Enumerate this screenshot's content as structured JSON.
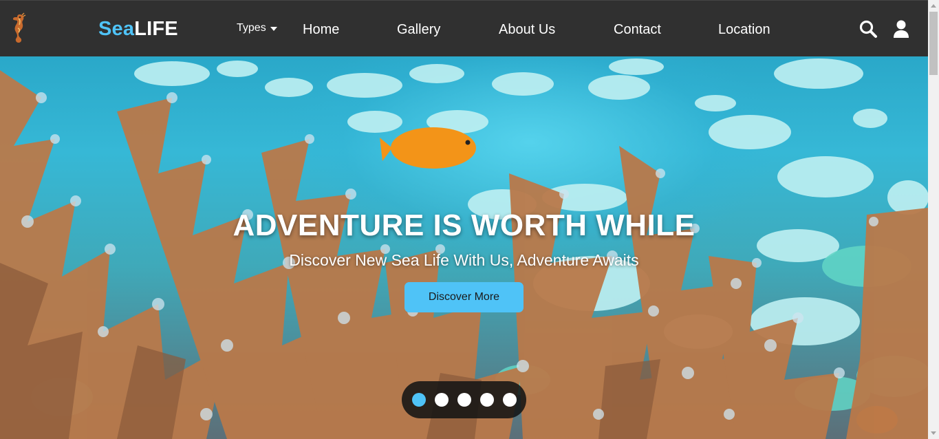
{
  "brand": {
    "part1": "Sea",
    "part2": "LIFE"
  },
  "nav": {
    "types_label": "Types",
    "links": [
      "Home",
      "Gallery",
      "About Us",
      "Contact",
      "Location"
    ]
  },
  "icons": {
    "logo": "seahorse-icon",
    "search": "search-icon",
    "user": "user-icon",
    "caret": "caret-down-icon"
  },
  "hero": {
    "title": "ADVENTURE IS WORTH WHILE",
    "subtitle": "Discover New Sea Life With Us, Adventure Awaits",
    "button_label": "Discover More",
    "slides_count": 5,
    "active_slide": 1
  },
  "colors": {
    "accent": "#4fc3f7",
    "navbar": "#303030"
  }
}
